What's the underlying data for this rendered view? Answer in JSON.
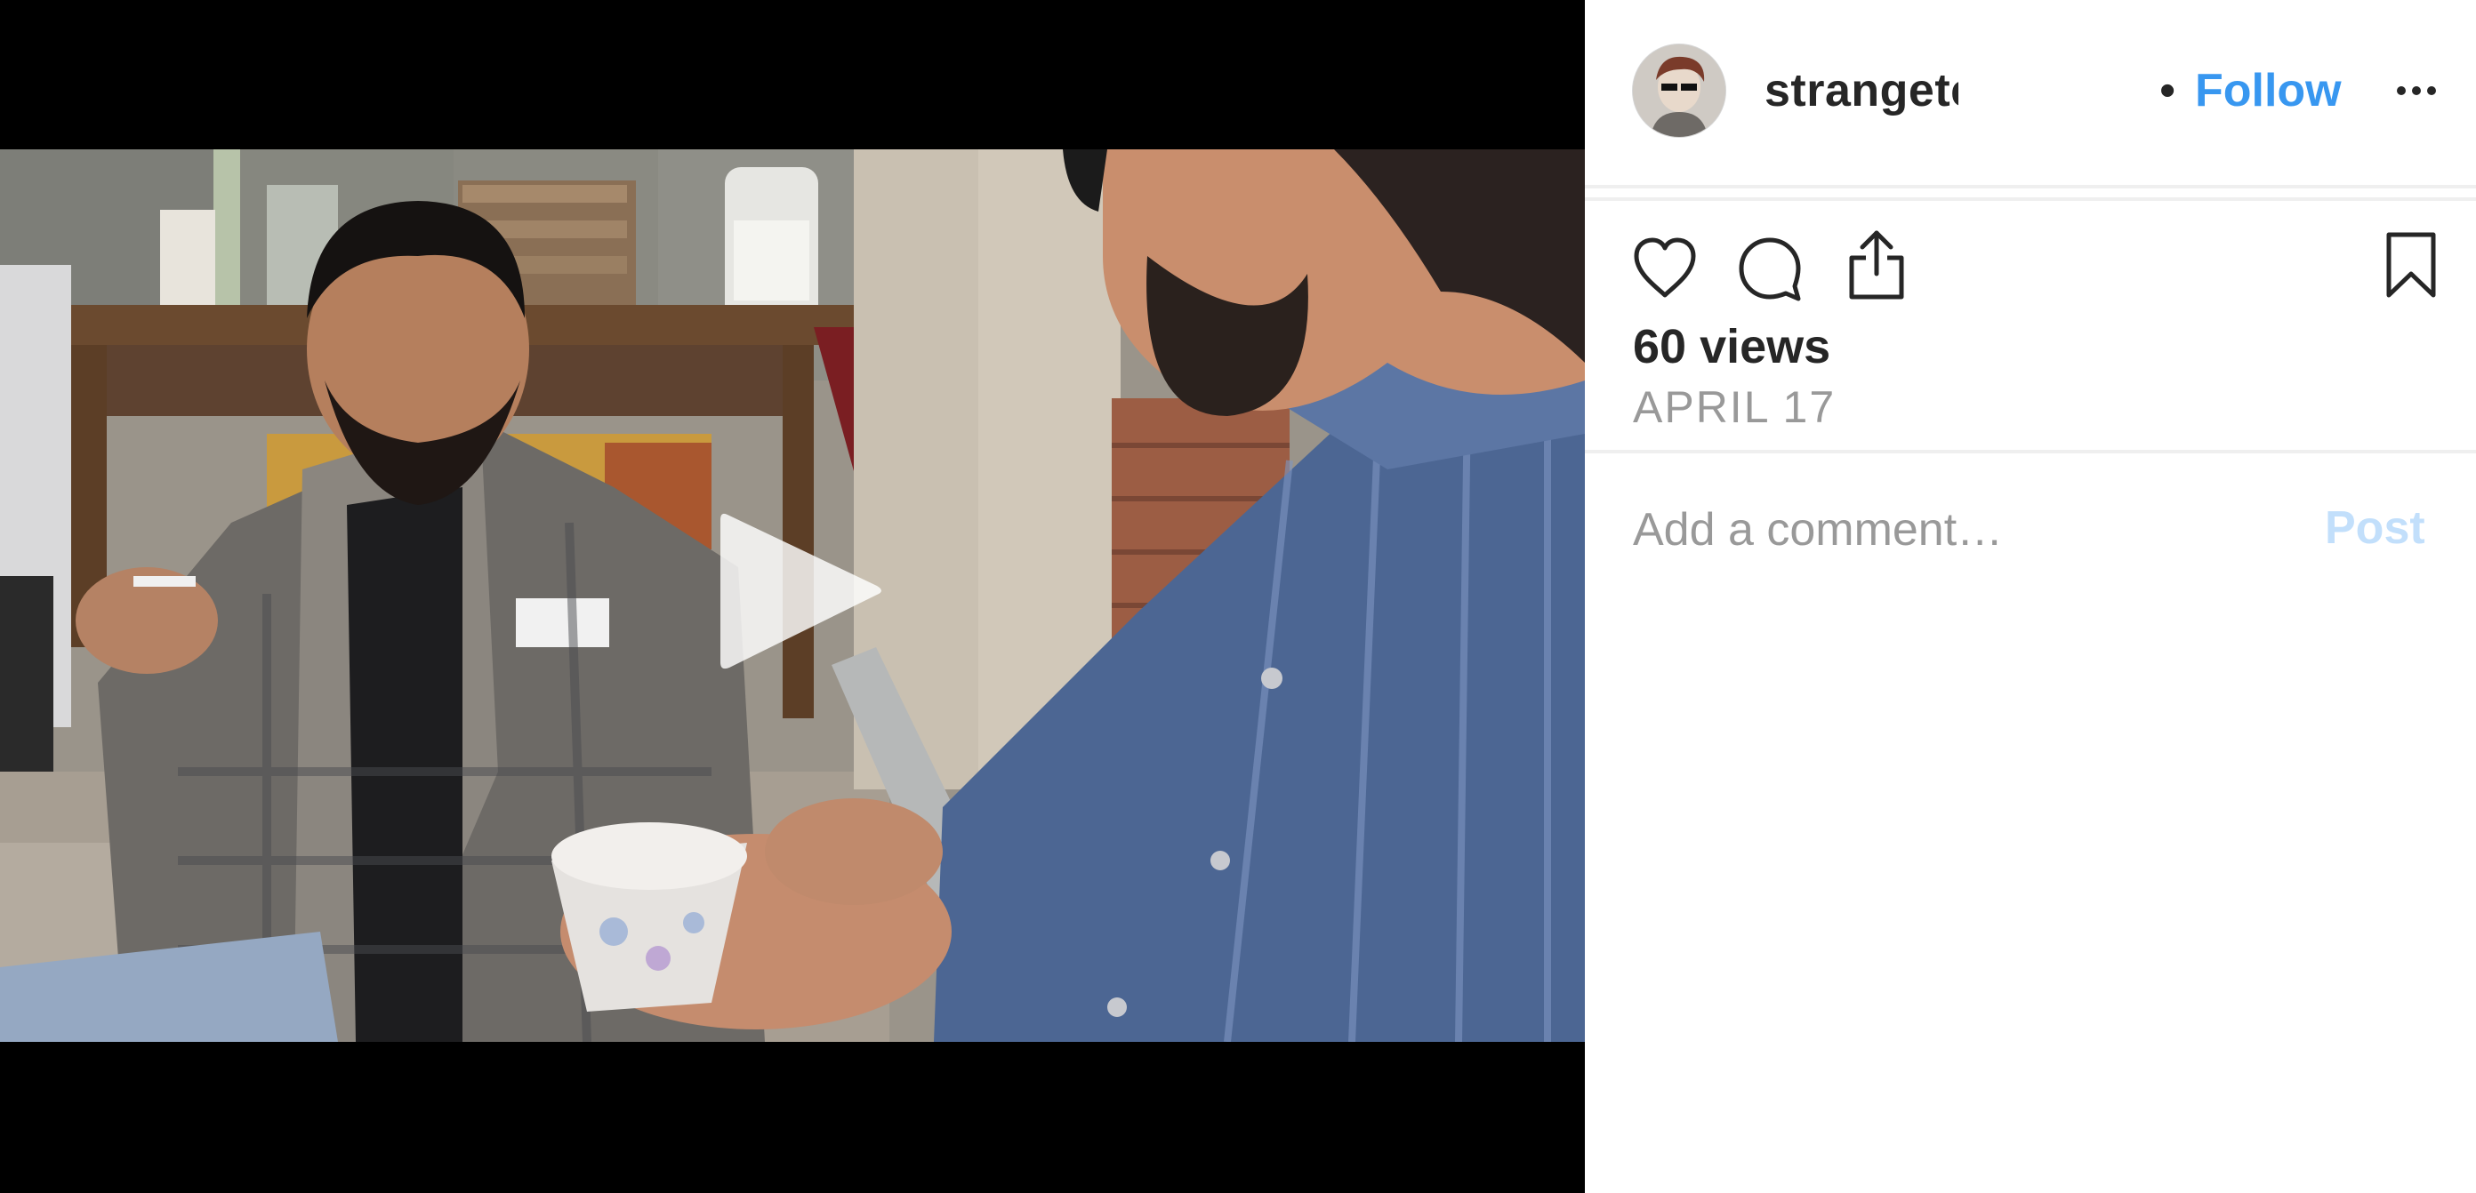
{
  "post": {
    "username": "strangeteachings",
    "separator": "•",
    "follow_label": "Follow",
    "more_icon": "more-horizontal-icon",
    "views_label": "60 views",
    "date_label": "APRIL 17"
  },
  "actions": {
    "like_icon": "heart-icon",
    "comment_icon": "comment-bubble-icon",
    "share_icon": "share-upload-icon",
    "save_icon": "bookmark-icon"
  },
  "comment": {
    "placeholder": "Add a comment…",
    "value": "",
    "post_label": "Post"
  },
  "video": {
    "play_icon": "play-icon"
  },
  "colors": {
    "link_blue": "#3897f0",
    "post_disabled": "#c2dffb",
    "text_primary": "#262626",
    "text_secondary": "#999999",
    "divider": "#efefef",
    "letterbox": "#000000"
  }
}
